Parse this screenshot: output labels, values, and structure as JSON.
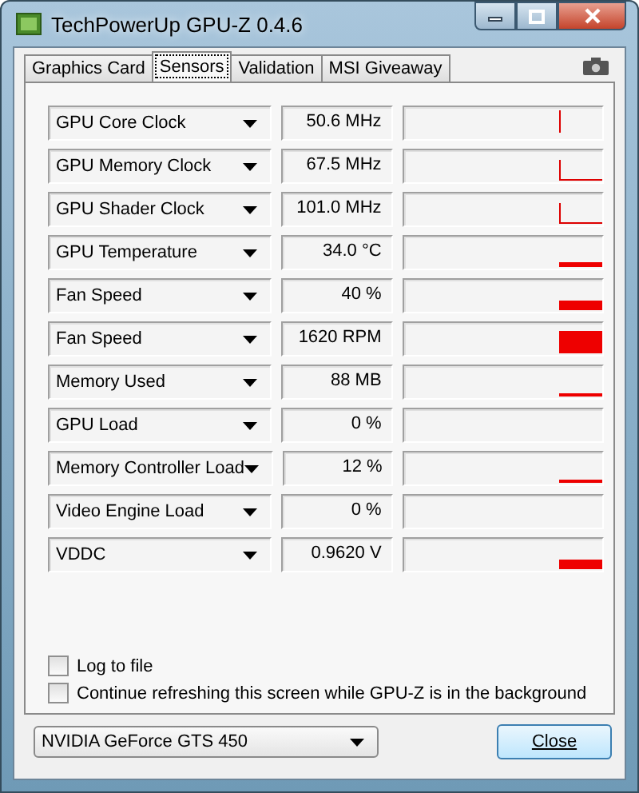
{
  "window": {
    "title": "TechPowerUp GPU-Z 0.4.6"
  },
  "tabs": [
    {
      "label": "Graphics Card",
      "selected": false
    },
    {
      "label": "Sensors",
      "selected": true
    },
    {
      "label": "Validation",
      "selected": false
    },
    {
      "label": "MSI Giveaway",
      "selected": false
    }
  ],
  "sensors": [
    {
      "name": "GPU Core Clock",
      "reading": "50.6 MHz",
      "kind": "spike"
    },
    {
      "name": "GPU Memory Clock",
      "reading": "67.5 MHz",
      "kind": "step"
    },
    {
      "name": "GPU Shader Clock",
      "reading": "101.0 MHz",
      "kind": "step"
    },
    {
      "name": "GPU Temperature",
      "reading": "34.0 °C",
      "kind": "line"
    },
    {
      "name": "Fan Speed",
      "reading": "40 %",
      "kind": "bar"
    },
    {
      "name": "Fan Speed",
      "reading": "1620 RPM",
      "kind": "tall-bar"
    },
    {
      "name": "Memory Used",
      "reading": "88 MB",
      "kind": "thin-line"
    },
    {
      "name": "GPU Load",
      "reading": "0 %",
      "kind": "none"
    },
    {
      "name": "Memory Controller Load",
      "reading": "12 %",
      "kind": "thin-line"
    },
    {
      "name": "Video Engine Load",
      "reading": "0 %",
      "kind": "none"
    },
    {
      "name": "VDDC",
      "reading": "0.9620 V",
      "kind": "bar"
    }
  ],
  "options": [
    {
      "label": "Log to file",
      "checked": false
    },
    {
      "label": "Continue refreshing this screen while GPU-Z is in the background",
      "checked": false
    }
  ],
  "gpu_select": {
    "value": "NVIDIA GeForce GTS 450"
  },
  "buttons": [
    {
      "label": "Close"
    }
  ]
}
